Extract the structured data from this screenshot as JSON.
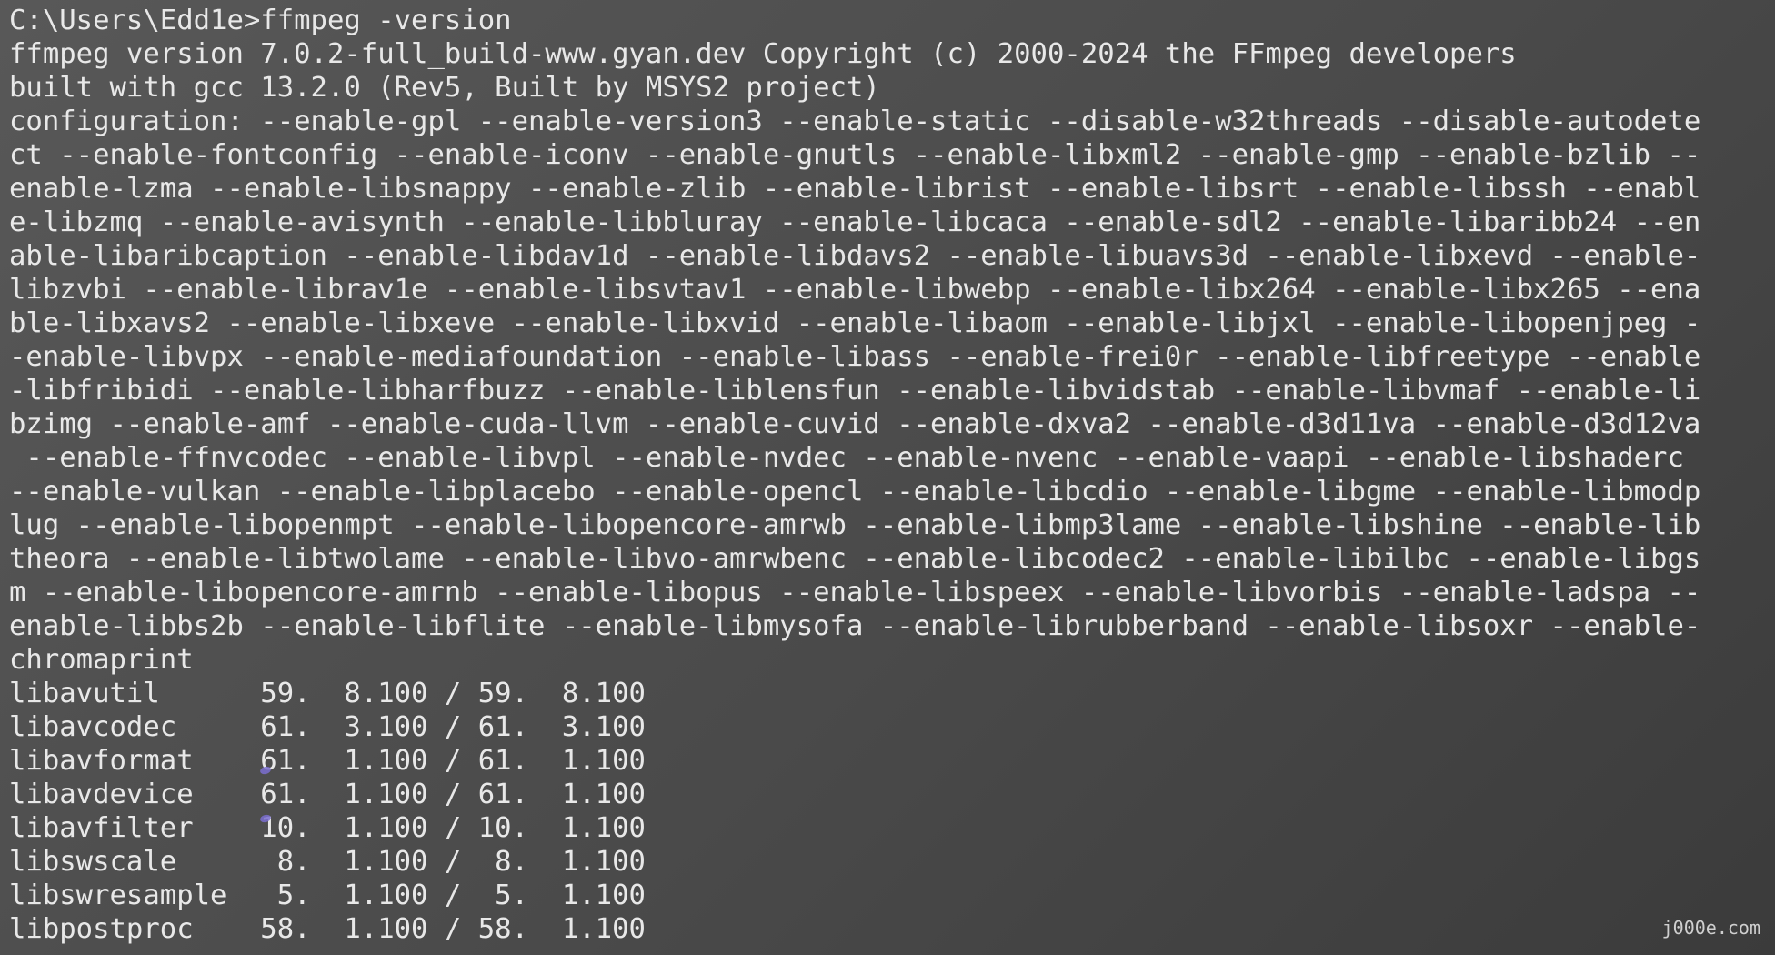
{
  "terminal": {
    "lines": [
      "C:\\Users\\Edd1e>ffmpeg -version",
      "ffmpeg version 7.0.2-full_build-www.gyan.dev Copyright (c) 2000-2024 the FFmpeg developers",
      "built with gcc 13.2.0 (Rev5, Built by MSYS2 project)",
      "configuration: --enable-gpl --enable-version3 --enable-static --disable-w32threads --disable-autodete",
      "ct --enable-fontconfig --enable-iconv --enable-gnutls --enable-libxml2 --enable-gmp --enable-bzlib --",
      "enable-lzma --enable-libsnappy --enable-zlib --enable-librist --enable-libsrt --enable-libssh --enabl",
      "e-libzmq --enable-avisynth --enable-libbluray --enable-libcaca --enable-sdl2 --enable-libaribb24 --en",
      "able-libaribcaption --enable-libdav1d --enable-libdavs2 --enable-libuavs3d --enable-libxevd --enable-",
      "libzvbi --enable-librav1e --enable-libsvtav1 --enable-libwebp --enable-libx264 --enable-libx265 --ena",
      "ble-libxavs2 --enable-libxeve --enable-libxvid --enable-libaom --enable-libjxl --enable-libopenjpeg -",
      "-enable-libvpx --enable-mediafoundation --enable-libass --enable-frei0r --enable-libfreetype --enable",
      "-libfribidi --enable-libharfbuzz --enable-liblensfun --enable-libvidstab --enable-libvmaf --enable-li",
      "bzimg --enable-amf --enable-cuda-llvm --enable-cuvid --enable-dxva2 --enable-d3d11va --enable-d3d12va",
      " --enable-ffnvcodec --enable-libvpl --enable-nvdec --enable-nvenc --enable-vaapi --enable-libshaderc",
      "--enable-vulkan --enable-libplacebo --enable-opencl --enable-libcdio --enable-libgme --enable-libmodp",
      "lug --enable-libopenmpt --enable-libopencore-amrwb --enable-libmp3lame --enable-libshine --enable-lib",
      "theora --enable-libtwolame --enable-libvo-amrwbenc --enable-libcodec2 --enable-libilbc --enable-libgs",
      "m --enable-libopencore-amrnb --enable-libopus --enable-libspeex --enable-libvorbis --enable-ladspa --",
      "enable-libbs2b --enable-libflite --enable-libmysofa --enable-librubberband --enable-libsoxr --enable-",
      "chromaprint",
      "libavutil      59.  8.100 / 59.  8.100",
      "libavcodec     61.  3.100 / 61.  3.100",
      "libavformat    61.  1.100 / 61.  1.100",
      "libavdevice    61.  1.100 / 61.  1.100",
      "libavfilter    10.  1.100 / 10.  1.100",
      "libswscale      8.  1.100 /  8.  1.100",
      "libswresample   5.  1.100 /  5.  1.100",
      "libpostproc    58.  1.100 / 58.  1.100"
    ]
  },
  "watermark": "j000e.com",
  "colors": {
    "background": "#4d4d4d",
    "text": "#e8e8e8",
    "marker": "#7b6fd0"
  }
}
